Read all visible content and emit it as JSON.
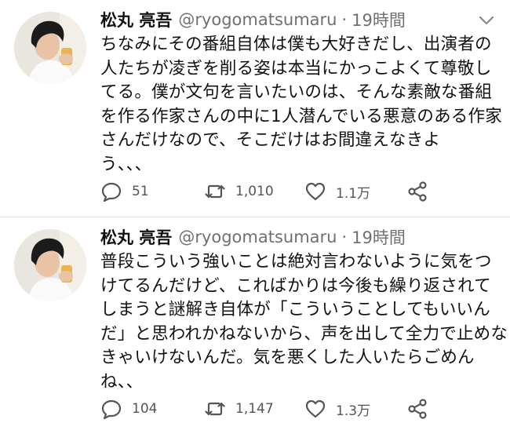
{
  "tweets": [
    {
      "name": "松丸 亮吾",
      "handle": "@ryogomatsumaru",
      "separator": "·",
      "time": "19時間",
      "lines": [
        "ちなみにその番組自体は僕も大好きだし、出演者の",
        "人たちが凌ぎを削る姿は本当にかっこよくて尊敬し",
        "てる。僕が文句を言いたいのは、そんな素敵な番組",
        "を作る作家さんの中に1人潜んでいる悪意のある作家",
        "さんだけなので、そこだけはお間違えなきよ",
        "う、、、"
      ],
      "replies": "51",
      "retweets": "1,010",
      "likes": "1.1万"
    },
    {
      "name": "松丸 亮吾",
      "handle": "@ryogomatsumaru",
      "separator": "·",
      "time": "19時間",
      "lines": [
        "普段こういう強いことは絶対言わないように気をつ",
        "けてるんだけど、こればかりは今後も繰り返されて",
        "しまうと謎解き自体が「こういうことしてもいいん",
        "だ」と思われかねないから、声を出して全力で止めな",
        "きゃいけないんだ。気を悪くした人いたらごめん",
        "ね、、"
      ],
      "replies": "104",
      "retweets": "1,147",
      "likes": "1.3万"
    }
  ],
  "icons": {
    "reply": "reply-icon",
    "retweet": "retweet-icon",
    "like": "heart-icon",
    "share": "share-icon",
    "caret": "chevron-down-icon"
  },
  "colors": {
    "text": "#111111",
    "secondary": "#707070",
    "icon": "#555555",
    "divider": "#e3e3e3"
  }
}
